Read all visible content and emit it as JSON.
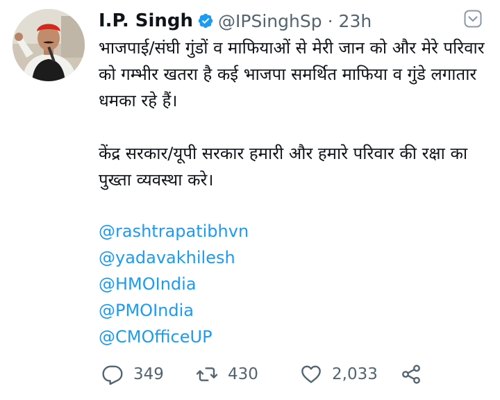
{
  "tweet": {
    "author_name": "I.P. Singh",
    "handle": "@IPSinghSp",
    "separator": "·",
    "time": "23h",
    "paragraphs": [
      "भाजपाई/संघी गुंडों व माफियाओं से मेरी जान को और मेरे परिवार को गम्भीर खतरा है कई भाजपा समर्थित माफिया व गुंडे लगातार धमका रहे हैं।",
      "केंद्र सरकार/यूपी सरकार हमारी और हमारे परिवार की रक्षा का पुख्ता व्यवस्था करे।"
    ],
    "mentions": [
      "@rashtrapatibhvn",
      "@yadavakhilesh",
      "@HMOIndia",
      "@PMOIndia",
      "@CMOfficeUP"
    ]
  },
  "actions": {
    "reply_count": "349",
    "retweet_count": "430",
    "like_count": "2,033"
  },
  "colors": {
    "text": "#0f1419",
    "secondary": "#536471",
    "link": "#1d9bf0",
    "verified": "#1d9bf0"
  },
  "icons": {
    "verified": "verified-badge-icon",
    "more": "chevron-down-icon",
    "reply": "reply-icon",
    "retweet": "retweet-icon",
    "like": "heart-icon",
    "share": "share-icon"
  }
}
